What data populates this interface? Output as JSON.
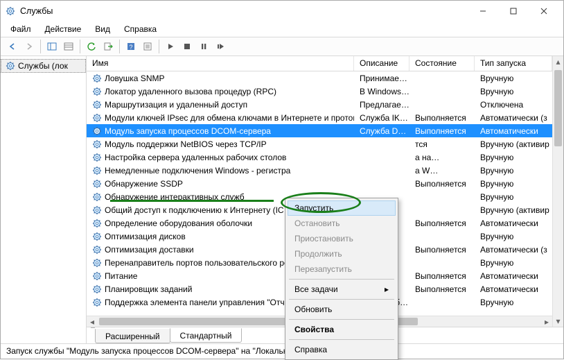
{
  "window": {
    "title": "Службы"
  },
  "menu": {
    "file": "Файл",
    "action": "Действие",
    "view": "Вид",
    "help": "Справка"
  },
  "nav": {
    "root": "Службы (лок"
  },
  "columns": {
    "name": "Имя",
    "description": "Описание",
    "state": "Состояние",
    "startup": "Тип запуска"
  },
  "services": [
    {
      "name": "Ловушка SNMP",
      "desc": "Принимае…",
      "state": "",
      "startup": "Вручную"
    },
    {
      "name": "Локатор удаленного вызова процедур (RPC)",
      "desc": "В Windows…",
      "state": "",
      "startup": "Вручную"
    },
    {
      "name": "Маршрутизация и удаленный доступ",
      "desc": "Предлагае…",
      "state": "",
      "startup": "Отключена"
    },
    {
      "name": "Модули ключей IPsec для обмена ключами в Интернете и протокол…",
      "desc": "Служба IK…",
      "state": "Выполняется",
      "startup": "Автоматически (з"
    },
    {
      "name": "Модуль запуска процессов DCOM-сервера",
      "desc": "Служба D…",
      "state": "Выполняется",
      "startup": "Автоматически",
      "selected": true
    },
    {
      "name": "Модуль поддержки NetBIOS через TCP/IP",
      "desc": "",
      "state": "тся",
      "startup": "Вручную (активир"
    },
    {
      "name": "Настройка сервера удаленных рабочих столов",
      "desc": "",
      "state": "а на…",
      "startup": "Вручную"
    },
    {
      "name": "Немедленные подключения Windows - регистра",
      "desc": "",
      "state": "а W…",
      "startup": "Вручную"
    },
    {
      "name": "Обнаружение SSDP",
      "desc": "",
      "state": "Выполняется",
      "startup": "Вручную"
    },
    {
      "name": "Обнаружение интерактивных служб",
      "desc": "",
      "state": "",
      "startup": "Вручную"
    },
    {
      "name": "Общий доступ к подключению к Интернету (IC",
      "desc": "",
      "state": "",
      "startup": "Вручную (активир"
    },
    {
      "name": "Определение оборудования оболочки",
      "desc": "",
      "state": "Выполняется",
      "startup": "Автоматически"
    },
    {
      "name": "Оптимизация дисков",
      "desc": "",
      "state": "",
      "startup": "Вручную"
    },
    {
      "name": "Оптимизация доставки",
      "desc": "",
      "state": "Выполняется",
      "startup": "Автоматически (з"
    },
    {
      "name": "Перенаправитель портов пользовательского ре",
      "desc": "",
      "state": "",
      "startup": "Вручную"
    },
    {
      "name": "Питание",
      "desc": "",
      "state": "Выполняется",
      "startup": "Автоматически"
    },
    {
      "name": "Планировщик заданий",
      "desc": "",
      "state": "Выполняется",
      "startup": "Автоматически"
    },
    {
      "name": "Поддержка элемента панели управления \"Отчеты о проблемах и их …",
      "desc": "Эта служб…",
      "state": "",
      "startup": "Вручную"
    }
  ],
  "context_menu": {
    "start": "Запустить",
    "stop": "Остановить",
    "pause": "Приостановить",
    "resume": "Продолжить",
    "restart": "Перезапустить",
    "all_tasks": "Все задачи",
    "refresh": "Обновить",
    "properties": "Свойства",
    "help": "Справка"
  },
  "tabs": {
    "extended": "Расширенный",
    "standard": "Стандартный"
  },
  "statusbar": "Запуск службы \"Модуль запуска процессов DCOM-сервера\" на \"Локальный компьютер\""
}
